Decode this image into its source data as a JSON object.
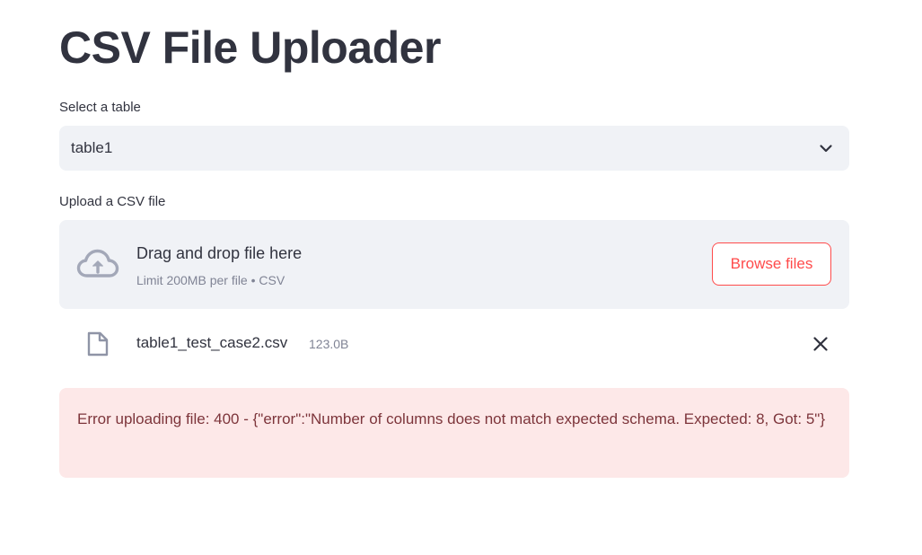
{
  "page": {
    "title": "CSV File Uploader"
  },
  "table_select": {
    "label": "Select a table",
    "value": "table1",
    "chevron_icon": "chevron-down-icon"
  },
  "upload": {
    "label": "Upload a CSV file",
    "dropzone_title": "Drag and drop file here",
    "dropzone_subtitle": "Limit 200MB per file • CSV",
    "browse_label": "Browse files",
    "cloud_icon": "cloud-upload-icon",
    "file": {
      "name": "table1_test_case2.csv",
      "size": "123.0B",
      "file_icon": "file-icon",
      "remove_icon": "close-icon"
    }
  },
  "alert": {
    "message": "Error uploading file: 400 - {\"error\":\"Number of columns does not match expected schema. Expected: 8, Got: 5\"}"
  },
  "colors": {
    "accent": "#ff4b4b",
    "text": "#31333f",
    "muted": "#808495",
    "input_bg": "#f0f2f6",
    "error_bg": "#fde8e8",
    "error_text": "#7d353b"
  }
}
